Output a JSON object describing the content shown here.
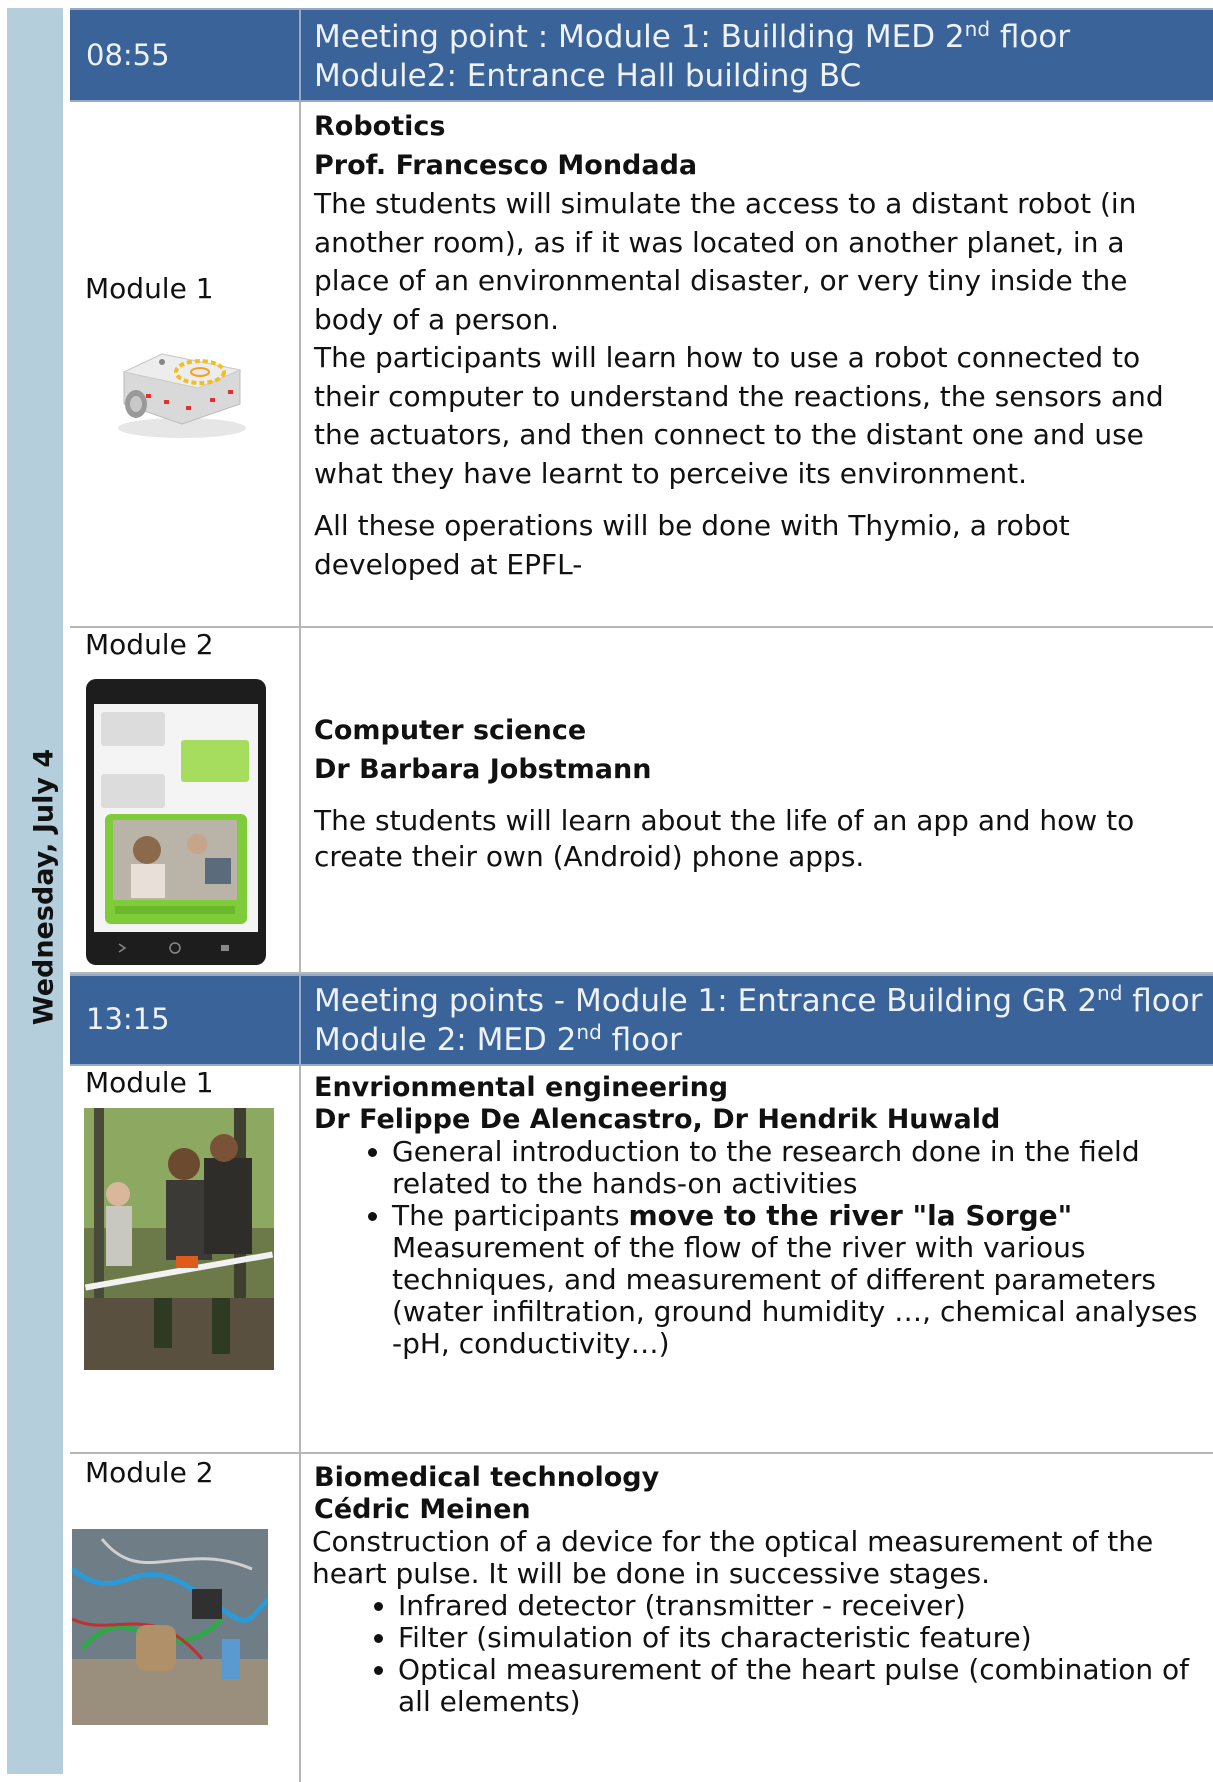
{
  "day_label": "Wednesday, July 4",
  "morning": {
    "time": "08:55",
    "meeting_line1_a": "Meeting point :  Module 1: Buillding MED 2",
    "meeting_line1_sup": "nd",
    "meeting_line1_b": " floor",
    "meeting_line2": "Module2: Entrance Hall building BC"
  },
  "robotics": {
    "module_label": "Module 1",
    "title": "Robotics",
    "teacher": "Prof. Francesco Mondada",
    "para1": "The students will simulate the access to a distant robot (in another room), as if it was located on another planet, in a place of an environmental disaster, or very tiny inside the body of a person.",
    "para2": "The participants will learn how to use a robot connected to their computer to understand the reactions, the sensors and the actuators, and then connect to the distant one and use what they have learnt to perceive its environment.",
    "para3": "All these operations will be done with Thymio, a robot developed at EPFL-"
  },
  "cs": {
    "module_label": "Module 2",
    "title": "Computer science",
    "teacher": "Dr Barbara Jobstmann",
    "para1": "The students will learn about the life of an app and how to create their own (Android) phone apps."
  },
  "afternoon": {
    "time": "13:15",
    "meeting_line1_a": "Meeting points  - Module 1: Entrance Building GR 2",
    "meeting_line1_sup": "nd",
    "meeting_line1_b": " floor",
    "meeting_line2_a": "Module 2: MED 2",
    "meeting_line2_sup": "nd",
    "meeting_line2_b": " floor"
  },
  "env": {
    "module_label": "Module 1",
    "title": "Envrionmental engineering",
    "teacher": "Dr Felippe De Alencastro, Dr Hendrik Huwald",
    "bullet1": "General introduction to the research done in the field related to the hands-on activities",
    "bullet2_a": "The participants ",
    "bullet2_bold": "move to the river \"la Sorge\"",
    "bullet2_b": "Measurement of the flow of the river with various techniques, and measurement of different parameters (water infiltration, ground humidity …, chemical analyses -pH, conductivity…)"
  },
  "bio": {
    "module_label": "Module 2",
    "title": "Biomedical technology",
    "teacher": "Cédric Meinen",
    "para1": "Construction of a device for the optical measurement of the heart pulse.  It will be done in successive stages.",
    "bullets": [
      "Infrared detector (transmitter - receiver)",
      "Filter (simulation of its characteristic feature)",
      "Optical measurement of the heart pulse (combination of all elements)"
    ]
  },
  "colors": {
    "header_bg": "#3a6399",
    "sidebar_bg": "#b5cedb"
  }
}
